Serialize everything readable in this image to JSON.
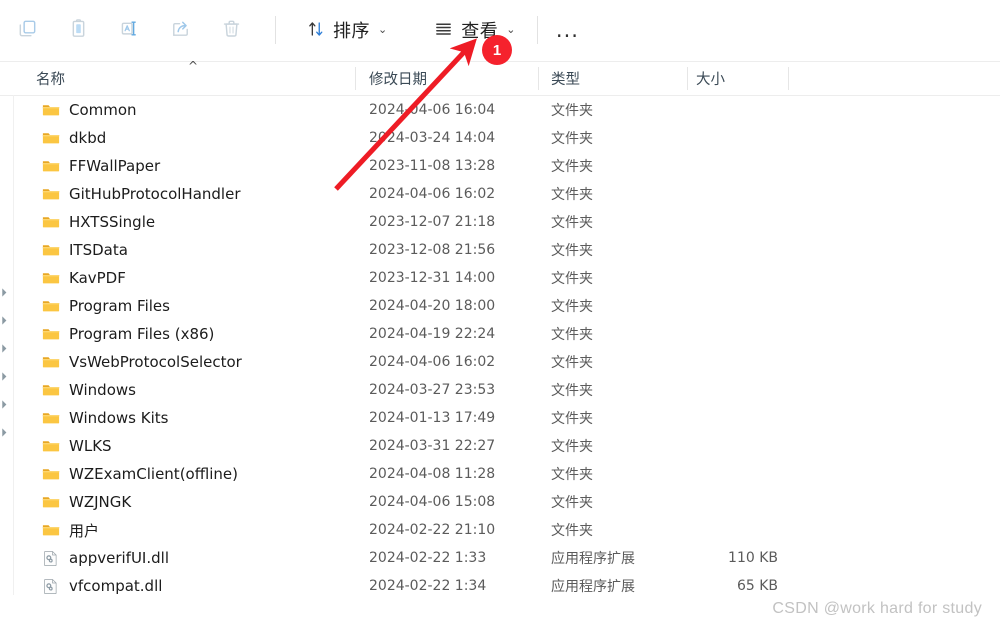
{
  "toolbar": {
    "icon_buttons": [
      {
        "name": "copy-icon",
        "label": "复制"
      },
      {
        "name": "paste-icon",
        "label": "粘贴"
      },
      {
        "name": "rename-icon",
        "label": "重命名"
      },
      {
        "name": "share-icon",
        "label": "共享"
      },
      {
        "name": "delete-icon",
        "label": "删除"
      }
    ],
    "sort_label": "排序",
    "view_label": "查看",
    "more_label": "..."
  },
  "columns": {
    "name": "名称",
    "date_modified": "修改日期",
    "type": "类型",
    "size": "大小",
    "sort_indicator": "^"
  },
  "files": [
    {
      "name": "Common",
      "date": "2024-04-06 16:04",
      "type": "文件夹",
      "size": "",
      "icon": "folder-icon"
    },
    {
      "name": "dkbd",
      "date": "2024-03-24 14:04",
      "type": "文件夹",
      "size": "",
      "icon": "folder-icon"
    },
    {
      "name": "FFWallPaper",
      "date": "2023-11-08 13:28",
      "type": "文件夹",
      "size": "",
      "icon": "folder-icon"
    },
    {
      "name": "GitHubProtocolHandler",
      "date": "2024-04-06 16:02",
      "type": "文件夹",
      "size": "",
      "icon": "folder-icon"
    },
    {
      "name": "HXTSSingle",
      "date": "2023-12-07 21:18",
      "type": "文件夹",
      "size": "",
      "icon": "folder-icon"
    },
    {
      "name": "ITSData",
      "date": "2023-12-08 21:56",
      "type": "文件夹",
      "size": "",
      "icon": "folder-icon"
    },
    {
      "name": "KavPDF",
      "date": "2023-12-31 14:00",
      "type": "文件夹",
      "size": "",
      "icon": "folder-icon"
    },
    {
      "name": "Program Files",
      "date": "2024-04-20 18:00",
      "type": "文件夹",
      "size": "",
      "icon": "folder-icon"
    },
    {
      "name": "Program Files (x86)",
      "date": "2024-04-19 22:24",
      "type": "文件夹",
      "size": "",
      "icon": "folder-icon"
    },
    {
      "name": "VsWebProtocolSelector",
      "date": "2024-04-06 16:02",
      "type": "文件夹",
      "size": "",
      "icon": "folder-icon"
    },
    {
      "name": "Windows",
      "date": "2024-03-27 23:53",
      "type": "文件夹",
      "size": "",
      "icon": "folder-icon"
    },
    {
      "name": "Windows Kits",
      "date": "2024-01-13 17:49",
      "type": "文件夹",
      "size": "",
      "icon": "folder-icon"
    },
    {
      "name": "WLKS",
      "date": "2024-03-31 22:27",
      "type": "文件夹",
      "size": "",
      "icon": "folder-icon"
    },
    {
      "name": "WZExamClient(offline)",
      "date": "2024-04-08 11:28",
      "type": "文件夹",
      "size": "",
      "icon": "folder-icon"
    },
    {
      "name": "WZJNGK",
      "date": "2024-04-06 15:08",
      "type": "文件夹",
      "size": "",
      "icon": "folder-icon"
    },
    {
      "name": "用户",
      "date": "2024-02-22 21:10",
      "type": "文件夹",
      "size": "",
      "icon": "folder-icon"
    },
    {
      "name": "appverifUI.dll",
      "date": "2024-02-22 1:33",
      "type": "应用程序扩展",
      "size": "110 KB",
      "icon": "dll-file-icon"
    },
    {
      "name": "vfcompat.dll",
      "date": "2024-02-22 1:34",
      "type": "应用程序扩展",
      "size": "65 KB",
      "icon": "dll-file-icon"
    }
  ],
  "annotation": {
    "badge_number": "1",
    "arrow_color": "#ee1c25",
    "badge_color": "#f5222d"
  },
  "watermark": "CSDN @work hard for study"
}
